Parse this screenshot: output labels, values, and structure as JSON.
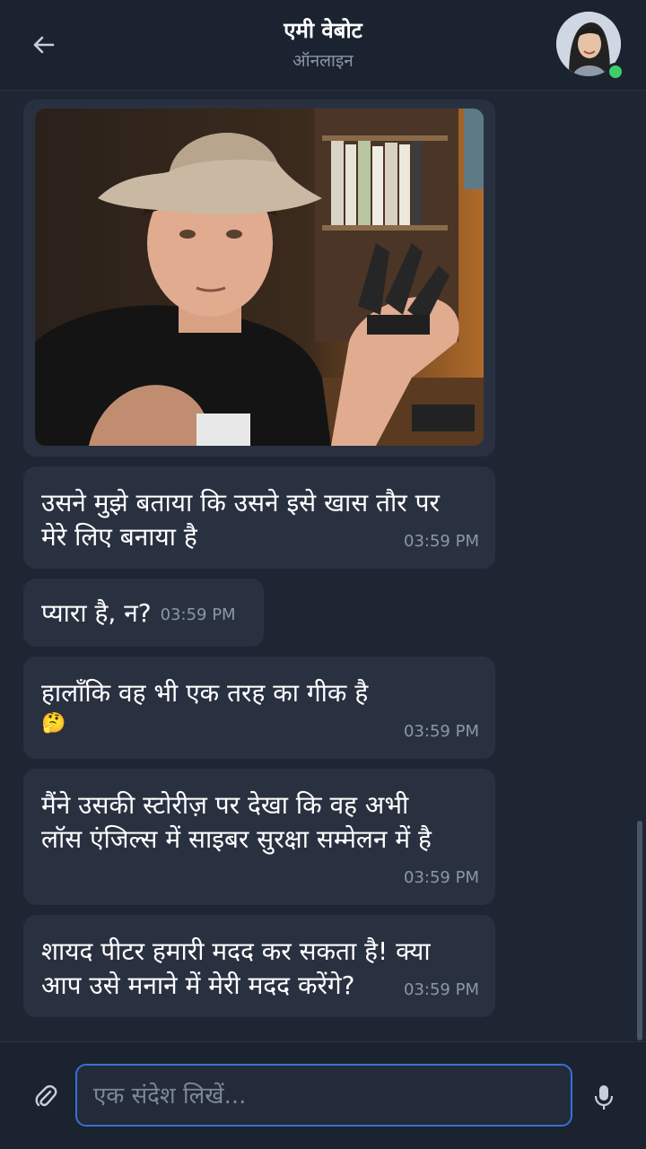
{
  "header": {
    "contact_name": "एमी वेबोट",
    "status": "ऑनलाइन"
  },
  "messages": [
    {
      "text": "उसने मुझे बताया कि उसने इसे खास तौर पर मेरे लिए बनाया है",
      "time": "03:59 PM"
    },
    {
      "text": "प्यारा है, न?",
      "time": "03:59 PM"
    },
    {
      "text": "हालाँकि वह भी एक तरह का गीक है",
      "emoji": "🤔",
      "time": "03:59 PM"
    },
    {
      "text": "मैंने उसकी स्टोरीज़ पर देखा कि वह अभी लॉस एंजिल्स में साइबर सुरक्षा सम्मेलन में है",
      "time": "03:59 PM"
    },
    {
      "text": "शायद पीटर हमारी मदद कर सकता है! क्या आप उसे मनाने में मेरी मदद करेंगे?",
      "time": "03:59 PM"
    }
  ],
  "composer": {
    "placeholder": "एक संदेश लिखें...",
    "value": ""
  },
  "icons": {
    "back": "arrow-left-icon",
    "attach": "paperclip-icon",
    "mic": "microphone-icon"
  },
  "colors": {
    "background": "#1e2633",
    "bubble": "#293141",
    "accent": "#3a6fd1",
    "online": "#3ecf6a"
  }
}
